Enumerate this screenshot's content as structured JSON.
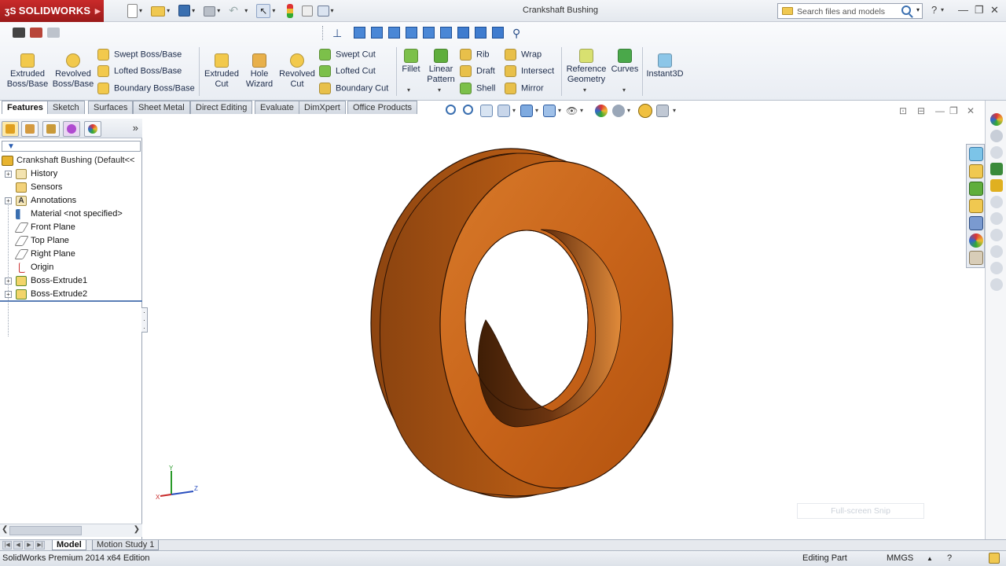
{
  "app": {
    "name": "SOLIDWORKS",
    "document_title": "Crankshaft Bushing",
    "search_placeholder": "Search files and models",
    "help_label": "?"
  },
  "command_manager": {
    "large_items": [
      {
        "label": "Extruded\nBoss/Base",
        "icon": "extruded-boss-icon"
      },
      {
        "label": "Revolved\nBoss/Base",
        "icon": "revolved-boss-icon"
      },
      {
        "label": "Extruded\nCut",
        "icon": "extruded-cut-icon"
      },
      {
        "label": "Hole\nWizard",
        "icon": "hole-wizard-icon"
      },
      {
        "label": "Revolved\nCut",
        "icon": "revolved-cut-icon"
      },
      {
        "label": "Fillet",
        "icon": "fillet-icon"
      },
      {
        "label": "Linear\nPattern",
        "icon": "linear-pattern-icon"
      },
      {
        "label": "Reference\nGeometry",
        "icon": "reference-geometry-icon"
      },
      {
        "label": "Curves",
        "icon": "curves-icon"
      },
      {
        "label": "Instant3D",
        "icon": "instant3d-icon"
      }
    ],
    "small_items": [
      {
        "label": "Swept Boss/Base",
        "icon": "swept-boss-icon"
      },
      {
        "label": "Lofted Boss/Base",
        "icon": "lofted-boss-icon"
      },
      {
        "label": "Boundary Boss/Base",
        "icon": "boundary-boss-icon"
      },
      {
        "label": "Swept Cut",
        "icon": "swept-cut-icon"
      },
      {
        "label": "Lofted Cut",
        "icon": "lofted-cut-icon"
      },
      {
        "label": "Boundary Cut",
        "icon": "boundary-cut-icon"
      },
      {
        "label": "Rib",
        "icon": "rib-icon"
      },
      {
        "label": "Draft",
        "icon": "draft-icon"
      },
      {
        "label": "Shell",
        "icon": "shell-icon"
      },
      {
        "label": "Wrap",
        "icon": "wrap-icon"
      },
      {
        "label": "Intersect",
        "icon": "intersect-icon"
      },
      {
        "label": "Mirror",
        "icon": "mirror-icon"
      }
    ]
  },
  "tabs": [
    "Features",
    "Sketch",
    "Surfaces",
    "Sheet Metal",
    "Direct Editing",
    "Evaluate",
    "DimXpert",
    "Office Products"
  ],
  "active_tab": "Features",
  "feature_tree": {
    "root": "Crankshaft Bushing  (Default<<",
    "items": [
      {
        "label": "History",
        "icon": "history-icon",
        "expandable": true
      },
      {
        "label": "Sensors",
        "icon": "sensors-icon",
        "expandable": false
      },
      {
        "label": "Annotations",
        "icon": "annotations-icon",
        "expandable": true
      },
      {
        "label": "Material <not specified>",
        "icon": "material-icon",
        "expandable": false
      },
      {
        "label": "Front Plane",
        "icon": "plane-icon",
        "expandable": false
      },
      {
        "label": "Top Plane",
        "icon": "plane-icon",
        "expandable": false
      },
      {
        "label": "Right Plane",
        "icon": "plane-icon",
        "expandable": false
      },
      {
        "label": "Origin",
        "icon": "origin-icon",
        "expandable": false
      },
      {
        "label": "Boss-Extrude1",
        "icon": "boss-extrude-icon",
        "expandable": true
      },
      {
        "label": "Boss-Extrude2",
        "icon": "boss-extrude-icon",
        "expandable": true
      }
    ]
  },
  "bottom_tabs": [
    "Model",
    "Motion Study 1"
  ],
  "active_bottom_tab": "Model",
  "status_bar": {
    "edition": "SolidWorks Premium 2014 x64 Edition",
    "mode": "Editing Part",
    "units": "MMGS",
    "units_arrow": "▲"
  },
  "overlay": {
    "snip_label": "Full-screen Snip"
  },
  "colors": {
    "part_body": "#c8641a",
    "part_shadow": "#7a3a0e",
    "brand_red": "#c92a2a"
  }
}
